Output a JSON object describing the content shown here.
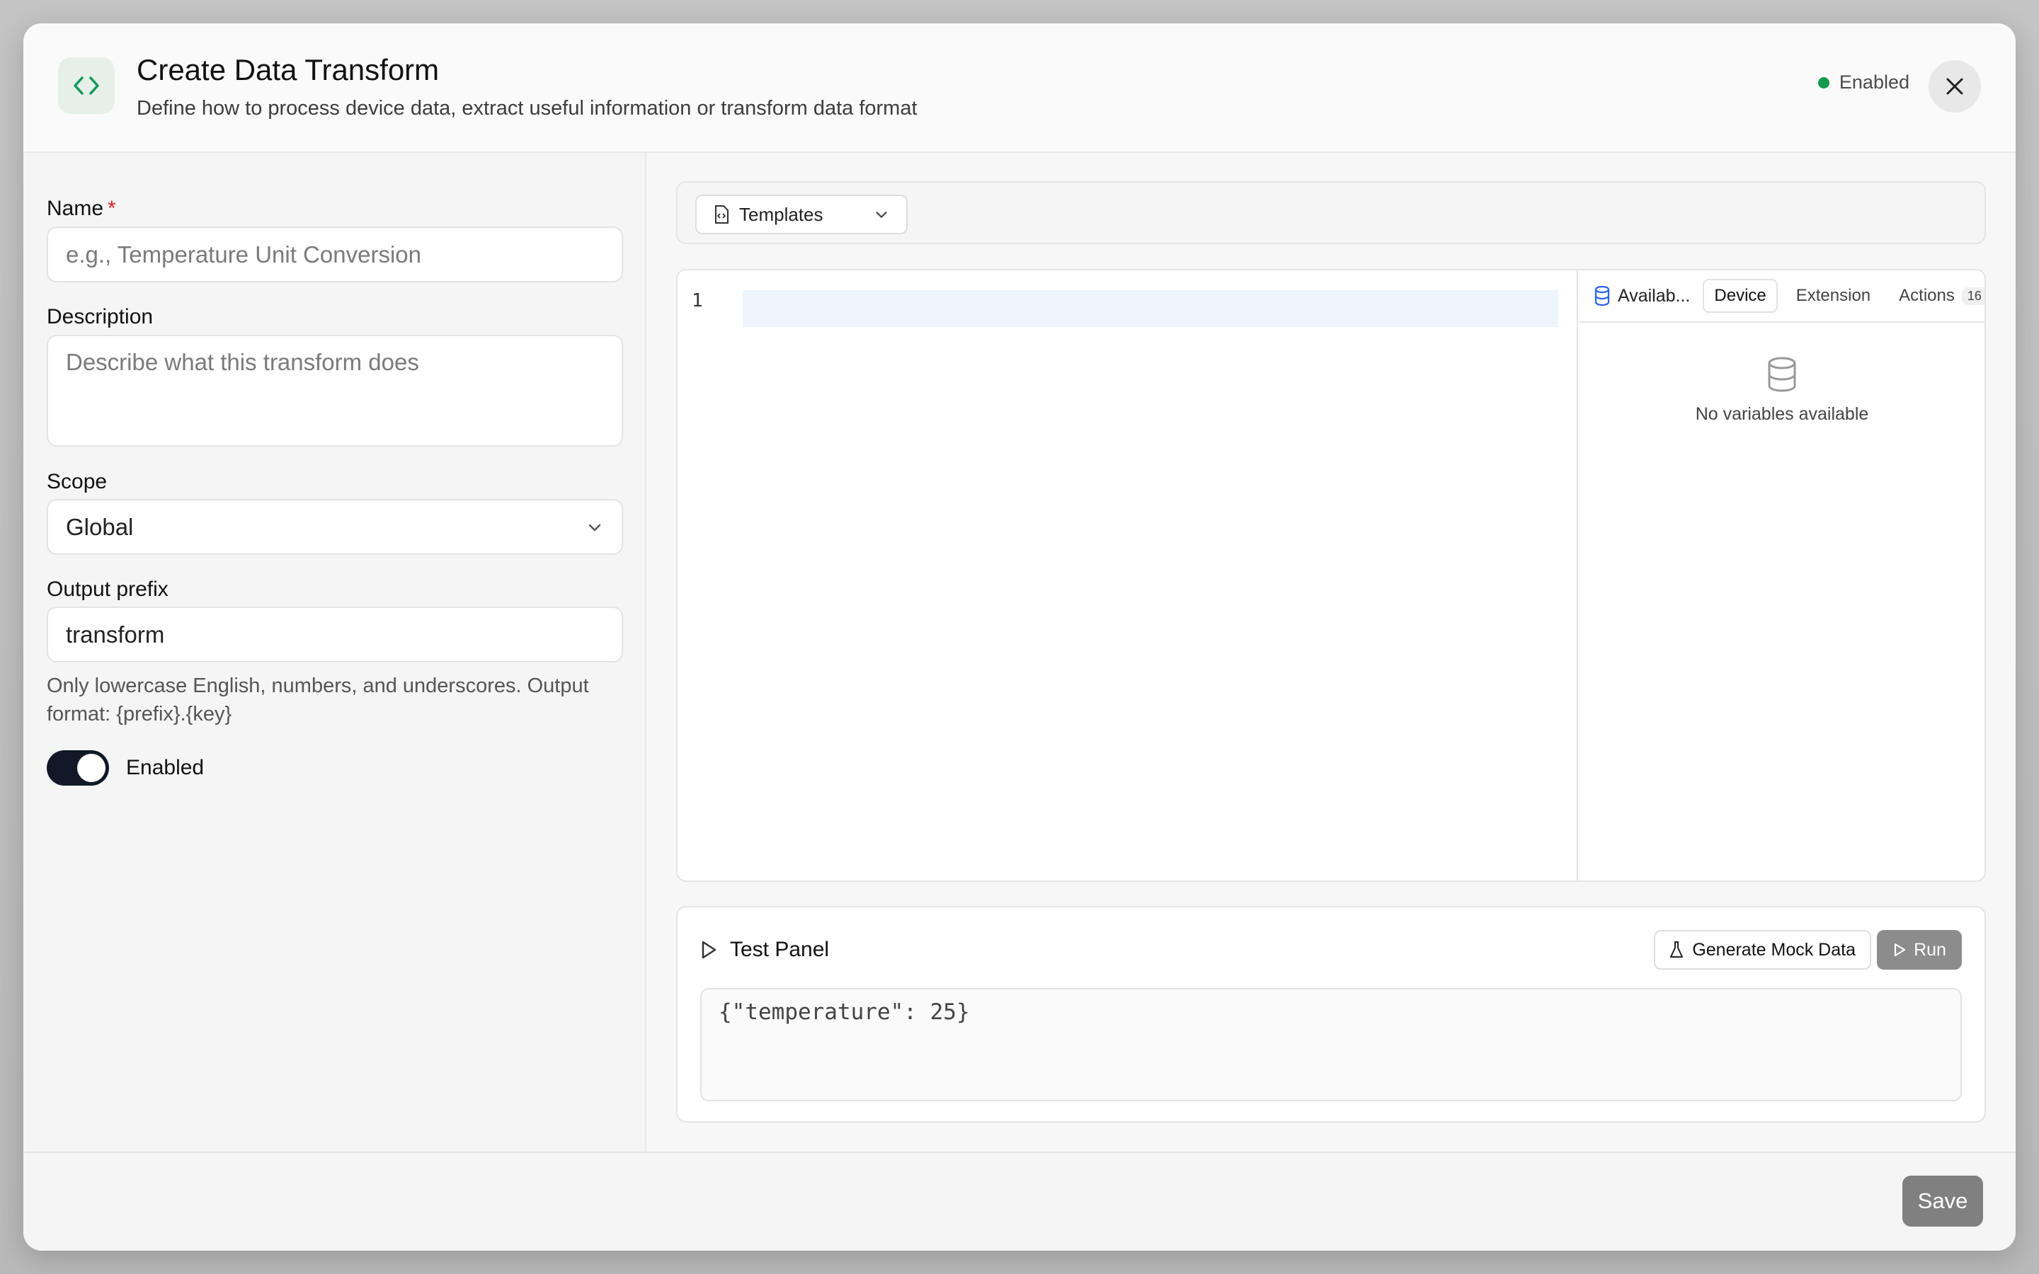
{
  "header": {
    "title": "Create Data Transform",
    "subtitle": "Define how to process device data, extract useful information or transform data format",
    "status": "Enabled",
    "icon": "code-icon",
    "close_icon": "close-icon"
  },
  "form": {
    "name_label": "Name",
    "required_mark": "*",
    "name_placeholder": "e.g., Temperature Unit Conversion",
    "description_label": "Description",
    "description_placeholder": "Describe what this transform does",
    "scope_label": "Scope",
    "scope_value": "Global",
    "output_prefix_label": "Output prefix",
    "output_prefix_value": "transform",
    "output_prefix_help": "Only lowercase English, numbers, and underscores. Output format: {prefix}.{key}",
    "enabled_label": "Enabled",
    "enabled": true
  },
  "toolbar": {
    "templates_label": "Templates"
  },
  "editor": {
    "line_numbers": [
      "1"
    ]
  },
  "variables": {
    "title": "Availab...",
    "tabs": [
      {
        "label": "Device",
        "active": true
      },
      {
        "label": "Extension",
        "active": false
      },
      {
        "label": "Actions",
        "active": false,
        "badge": "16"
      }
    ],
    "empty_text": "No variables available"
  },
  "test_panel": {
    "title": "Test Panel",
    "generate_label": "Generate Mock Data",
    "run_label": "Run",
    "input_value": "{\"temperature\": 25}"
  },
  "footer": {
    "save_label": "Save"
  },
  "colors": {
    "accent": "#111827",
    "success": "#169a4e",
    "required": "#dc2626"
  }
}
